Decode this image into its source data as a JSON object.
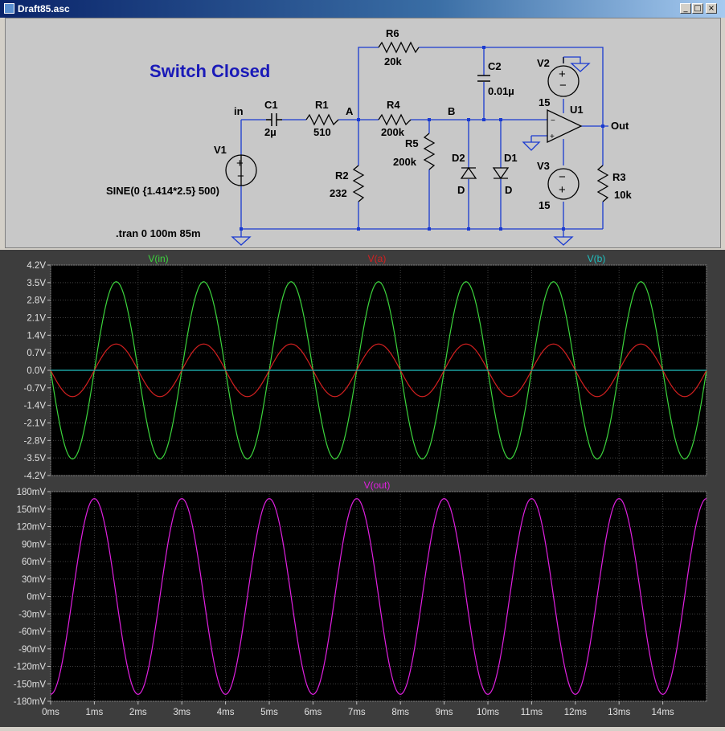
{
  "window": {
    "title": "Draft85.asc",
    "buttons": [
      "_",
      "□",
      "×"
    ]
  },
  "schematic": {
    "heading": "Switch Closed",
    "nodes": {
      "in": "in",
      "A": "A",
      "B": "B",
      "out": "Out"
    },
    "components": {
      "R6": {
        "name": "R6",
        "value": "20k"
      },
      "C2": {
        "name": "C2",
        "value": "0.01µ"
      },
      "V2": {
        "name": "V2",
        "value": "15"
      },
      "U1": {
        "name": "U1"
      },
      "C1": {
        "name": "C1",
        "value": "2µ"
      },
      "R1": {
        "name": "R1",
        "value": "510"
      },
      "R4": {
        "name": "R4",
        "value": "200k"
      },
      "R5": {
        "name": "R5",
        "value": "200k"
      },
      "D2": {
        "name": "D2",
        "value": "D"
      },
      "D1": {
        "name": "D1",
        "value": "D"
      },
      "V1": {
        "name": "V1",
        "value": "SINE(0 {1.414*2.5} 500)"
      },
      "R2": {
        "name": "R2",
        "value": "232"
      },
      "V3": {
        "name": "V3",
        "value": "15"
      },
      "R3": {
        "name": "R3",
        "value": "10k"
      }
    },
    "directive": ".tran 0 100m 85m"
  },
  "colors": {
    "vin": "#3cd43c",
    "va": "#d42020",
    "vb": "#20c0c0",
    "vout": "#e020e0",
    "wire": "#1a3ad0",
    "plot_bg": "#000000"
  },
  "chart_data": [
    {
      "type": "line",
      "title": "",
      "legend": [
        "V(in)",
        "V(a)",
        "V(b)"
      ],
      "yticks": [
        "4.2V",
        "3.5V",
        "2.8V",
        "2.1V",
        "1.4V",
        "0.7V",
        "0.0V",
        "-0.7V",
        "-1.4V",
        "-2.1V",
        "-2.8V",
        "-3.5V",
        "-4.2V"
      ],
      "ylim": [
        -4.2,
        4.2
      ],
      "xlim": [
        0,
        15
      ],
      "series": [
        {
          "name": "V(in)",
          "amplitude": 3.535,
          "frequency_hz": 500,
          "phase_deg": 180,
          "offset": 0
        },
        {
          "name": "V(a)",
          "amplitude": 1.05,
          "frequency_hz": 500,
          "phase_deg": 180,
          "offset": 0
        },
        {
          "name": "V(b)",
          "amplitude": 0.0,
          "frequency_hz": 500,
          "phase_deg": 0,
          "offset": 0
        }
      ]
    },
    {
      "type": "line",
      "title": "",
      "legend": [
        "V(out)"
      ],
      "yticks": [
        "180mV",
        "150mV",
        "120mV",
        "90mV",
        "60mV",
        "30mV",
        "0mV",
        "-30mV",
        "-60mV",
        "-90mV",
        "-120mV",
        "-150mV",
        "-180mV"
      ],
      "ylim": [
        -180,
        180
      ],
      "xlim": [
        0,
        15
      ],
      "xticks": [
        "0ms",
        "1ms",
        "2ms",
        "3ms",
        "4ms",
        "5ms",
        "6ms",
        "7ms",
        "8ms",
        "9ms",
        "10ms",
        "11ms",
        "12ms",
        "13ms",
        "14ms"
      ],
      "series": [
        {
          "name": "V(out)",
          "amplitude": 168,
          "frequency_hz": 500,
          "phase_deg": 90,
          "offset": 0,
          "sign": -1
        }
      ]
    }
  ]
}
